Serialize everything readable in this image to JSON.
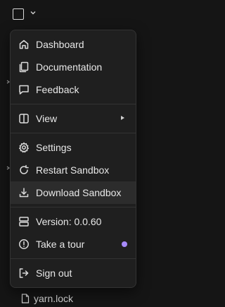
{
  "menu": {
    "dashboard": "Dashboard",
    "documentation": "Documentation",
    "feedback": "Feedback",
    "view": "View",
    "settings": "Settings",
    "restart_sandbox": "Restart Sandbox",
    "download_sandbox": "Download Sandbox",
    "version": "Version: 0.0.60",
    "take_a_tour": "Take a tour",
    "sign_out": "Sign out"
  },
  "background": {
    "file_name": "yarn.lock"
  },
  "colors": {
    "menu_background": "#1f1f1f",
    "highlight": "#2c2c2c",
    "tour_dot": "#a78bfa"
  }
}
